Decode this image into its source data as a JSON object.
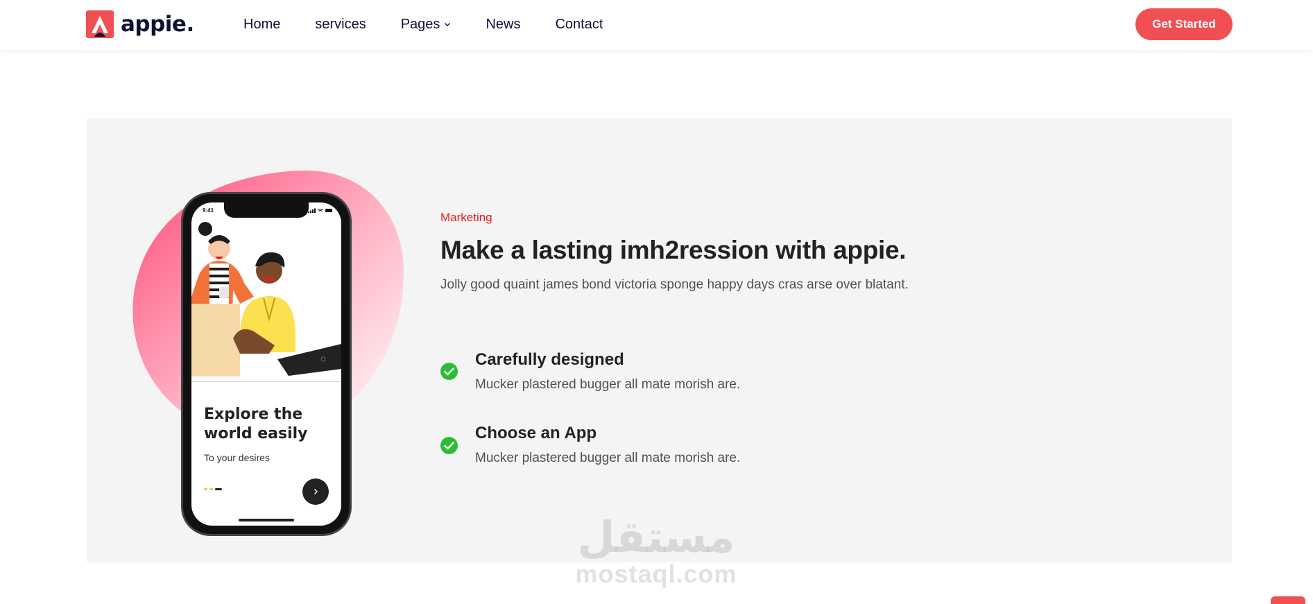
{
  "header": {
    "logo_text": "appie.",
    "nav": [
      "Home",
      "services",
      "Pages",
      "News",
      "Contact"
    ],
    "cta_label": "Get Started"
  },
  "feature": {
    "eyebrow": "Marketing",
    "heading": "Make a lasting imh2ression with appie.",
    "lead": "Jolly good quaint james bond victoria sponge happy days cras arse over blatant.",
    "items": [
      {
        "title": "Carefully designed",
        "text": "Mucker plastered bugger all mate morish are."
      },
      {
        "title": "Choose an App",
        "text": "Mucker plastered bugger all mate morish are."
      }
    ],
    "phone": {
      "time": "9:41",
      "title": "Explore the world easily",
      "subtitle": "To your desires"
    }
  },
  "watermark": {
    "arabic": "مستقل",
    "latin": "mostaql.com"
  },
  "colors": {
    "accent": "#f04f53",
    "eyebrow": "#e81b1b",
    "check": "#2bbd34",
    "section_bg": "#f4f4f4"
  },
  "icons": [
    "appie-logo-icon",
    "chevron-down-icon",
    "check-circle-icon",
    "arrow-right-icon",
    "signal-icon",
    "wifi-icon",
    "battery-icon",
    "back-to-top-icon"
  ]
}
